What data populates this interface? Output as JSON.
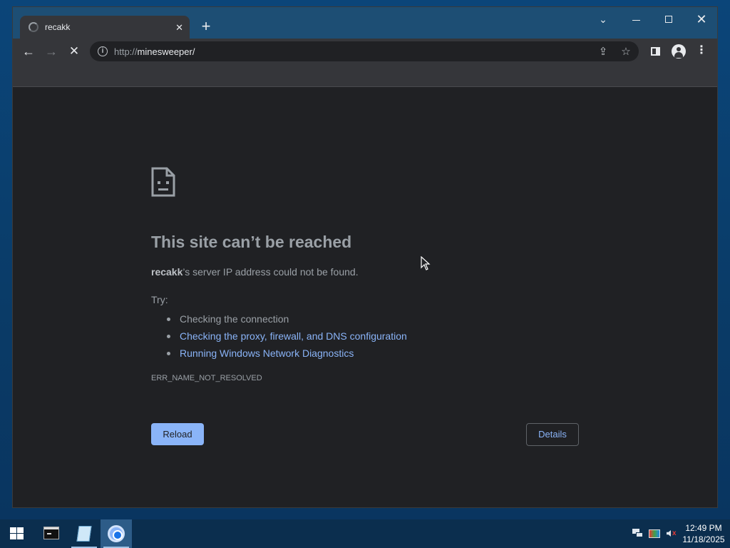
{
  "browser": {
    "tab": {
      "title": "recakk",
      "close_glyph": "✕"
    },
    "new_tab_glyph": "+",
    "window_controls": {
      "dropdown_glyph": "⌄",
      "close_glyph": "✕"
    },
    "toolbar": {
      "back_glyph": "←",
      "forward_glyph": "→",
      "stop_glyph": "✕",
      "url_scheme": "http://",
      "url_host": "minesweeper/",
      "info_glyph": "i",
      "share_glyph": "⇪",
      "star_glyph": "☆",
      "menu_glyph": "⋮"
    }
  },
  "error_page": {
    "title": "This site can’t be reached",
    "message_host": "recakk",
    "message_rest": "’s server IP address could not be found.",
    "try_label": "Try:",
    "suggestions": [
      {
        "text": "Checking the connection",
        "link": false
      },
      {
        "text": "Checking the proxy, firewall, and DNS configuration",
        "link": true
      },
      {
        "text": "Running Windows Network Diagnostics",
        "link": true
      }
    ],
    "error_code": "ERR_NAME_NOT_RESOLVED",
    "reload_label": "Reload",
    "details_label": "Details"
  },
  "taskbar": {
    "clock_time": "12:49 PM",
    "clock_date": "11/18/2025"
  },
  "icons": {
    "sad_page": "sad-page-icon",
    "start": "windows-logo-icon",
    "terminal": "terminal-icon",
    "notepad": "notepad-icon",
    "chrome": "chrome-icon",
    "network": "network-icon",
    "color": "color-management-icon",
    "volume": "volume-muted-icon"
  },
  "colors": {
    "page_bg": "#202124",
    "link": "#8ab4f8",
    "text_muted": "#9aa0a6",
    "titlebar": "#1d4e74",
    "taskbar": "#0b2e4e"
  }
}
